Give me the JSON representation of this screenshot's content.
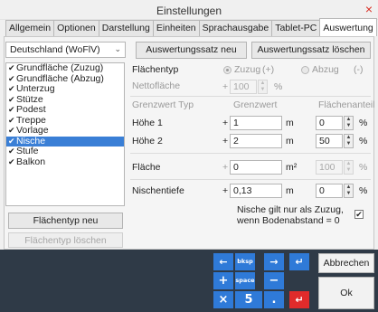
{
  "window": {
    "title": "Einstellungen",
    "close_glyph": "×"
  },
  "tabs": [
    "Allgemein",
    "Optionen",
    "Darstellung",
    "Einheiten",
    "Sprachausgabe",
    "Tablet-PC",
    "Auswertung"
  ],
  "active_tab": "Auswertung",
  "country_select": {
    "value": "Deutschland (WoFlV)",
    "caret": "⌄"
  },
  "buttons": {
    "new_set": "Auswertungssatz neu",
    "delete_set": "Auswertungssatz löschen",
    "new_type": "Flächentyp neu",
    "delete_type": "Flächentyp löschen",
    "cancel": "Abbrechen",
    "ok": "Ok"
  },
  "list": {
    "items": [
      {
        "label": "Grundfläche  (Zuzug)",
        "checked": true
      },
      {
        "label": "Grundfläche  (Abzug)",
        "checked": true
      },
      {
        "label": "Unterzug",
        "checked": true
      },
      {
        "label": "Stütze",
        "checked": true
      },
      {
        "label": "Podest",
        "checked": true
      },
      {
        "label": "Treppe",
        "checked": true
      },
      {
        "label": "Vorlage",
        "checked": true
      },
      {
        "label": "Nische",
        "checked": true,
        "selected": true
      },
      {
        "label": "Stufe",
        "checked": true
      },
      {
        "label": "Balkon",
        "checked": true
      }
    ],
    "check_glyph": "✔"
  },
  "form": {
    "flaechentyp_label": "Flächentyp",
    "zuzug": "Zuzug",
    "zuzug_sign": "(+)",
    "abzug": "Abzug",
    "abzug_sign": "(-)",
    "nettoflaeche_label": "Nettofläche",
    "netto_sign": "+",
    "netto_value": "100",
    "percent": "%",
    "col_typ": "Grenzwert Typ",
    "col_grenzwert": "Grenzwert",
    "col_anteil": "Flächenanteil",
    "rows": [
      {
        "label": "Höhe 1",
        "sign": "+",
        "value": "1",
        "unit": "m",
        "share": "0",
        "pct": "%"
      },
      {
        "label": "Höhe 2",
        "sign": "+",
        "value": "2",
        "unit": "m",
        "share": "50",
        "pct": "%"
      },
      {
        "label": "Fläche",
        "sign": "+",
        "value": "0",
        "unit": "m²",
        "share": "100",
        "pct": "%"
      },
      {
        "label": "Nischentiefe",
        "sign": "+",
        "value": "0,13",
        "unit": "m",
        "share": "0",
        "pct": "%"
      }
    ],
    "niche_note": "Nische gilt nur als Zuzug, wenn Bodenabstand = 0",
    "niche_checked": true
  },
  "keypad": {
    "keys": [
      "←",
      "bksp",
      "→",
      "↵",
      "+",
      "space",
      "−",
      "×",
      "5",
      ".",
      "↵"
    ]
  }
}
